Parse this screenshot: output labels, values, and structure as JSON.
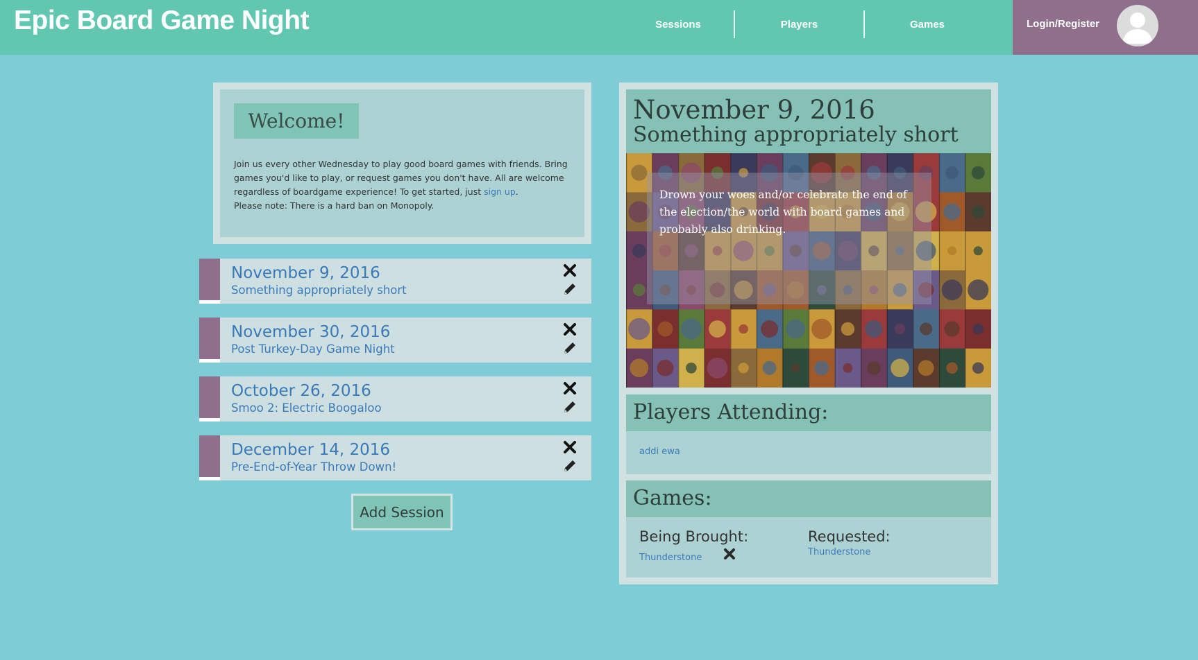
{
  "header": {
    "title": "Epic Board Game Night",
    "nav": [
      {
        "label": "Sessions"
      },
      {
        "label": "Players"
      },
      {
        "label": "Games"
      }
    ],
    "login_label": "Login/Register",
    "avatar_icon": "user-avatar-icon"
  },
  "welcome": {
    "title": "Welcome!",
    "text_before_link": "Join us every other Wednesday to play good board games with friends. Bring games you'd like to play, or request games you don't have. All are welcome regardless of boardgame experience! To get started, just ",
    "link_label": "sign up",
    "text_after_link": ".",
    "note": "Please note: There is a hard ban on Monopoly."
  },
  "sessions": [
    {
      "date": "November 9, 2016",
      "subtitle": "Something appropriately short"
    },
    {
      "date": "November 30, 2016",
      "subtitle": "Post Turkey-Day Game Night"
    },
    {
      "date": "October 26, 2016",
      "subtitle": "Smoo 2: Electric Boogaloo"
    },
    {
      "date": "December 14, 2016",
      "subtitle": "Pre-End-of-Year Throw Down!"
    }
  ],
  "add_session_label": "Add Session",
  "detail": {
    "date": "November 9, 2016",
    "subtitle": "Something appropriately short",
    "image_caption": "Drown your woes and/or celebrate the end of the election/the world with board games and probably also drinking.",
    "players_title": "Players Attending:",
    "players": [
      "addi ewa"
    ],
    "games_title": "Games:",
    "brought_title": "Being Brought:",
    "brought": [
      "Thunderstone"
    ],
    "requested_title": "Requested:",
    "requested": [
      "Thunderstone"
    ]
  },
  "colors": {
    "background": "#7ecdd6",
    "topbar": "#62c7b1",
    "accent_purple": "#8f6f8c",
    "link_blue": "#3a7ab8",
    "section_green": "#85c2b5"
  },
  "icons": {
    "delete": "close-x-icon",
    "edit": "pencil-icon"
  }
}
